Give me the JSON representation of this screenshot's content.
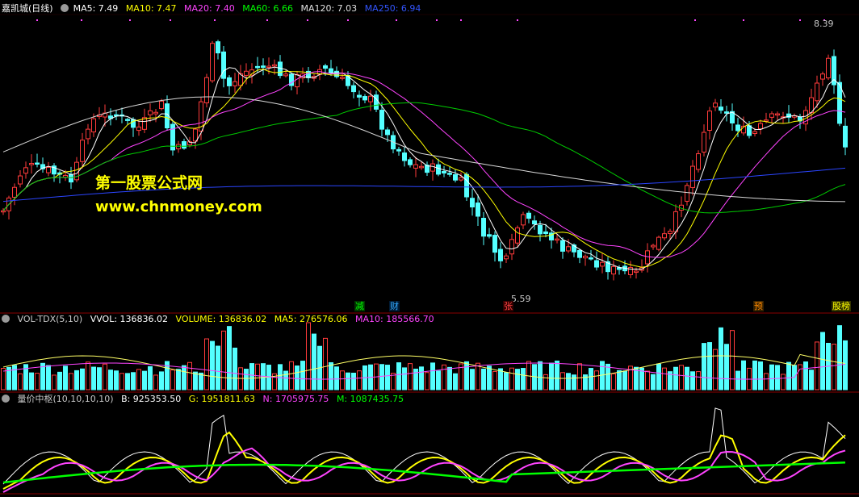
{
  "header_main": {
    "title": "嘉凯城(日线)",
    "items": [
      {
        "label": "MA5: 7.49",
        "color": "#ffffff"
      },
      {
        "label": "MA10: 7.47",
        "color": "#ffff00"
      },
      {
        "label": "MA20: 7.40",
        "color": "#ff44ff"
      },
      {
        "label": "MA60: 6.66",
        "color": "#00ff00"
      },
      {
        "label": "MA120: 7.03",
        "color": "#e0e0e0"
      },
      {
        "label": "MA250: 6.94",
        "color": "#3355ff"
      }
    ]
  },
  "header_vol": {
    "title": "VOL-TDX(5,10)",
    "items": [
      {
        "label": "VVOL: 136836.02",
        "color": "#ffffff"
      },
      {
        "label": "VOLUME: 136836.02",
        "color": "#ffff00"
      },
      {
        "label": "MA5: 276576.06",
        "color": "#ffff00"
      },
      {
        "label": "MA10: 185566.70",
        "color": "#ff44ff"
      }
    ]
  },
  "header_ind": {
    "title": "量价中枢(10,10,10,10)",
    "items": [
      {
        "label": "B: 925353.50",
        "color": "#ffffff"
      },
      {
        "label": "G: 1951811.63",
        "color": "#ffff00"
      },
      {
        "label": "N: 1705975.75",
        "color": "#ff44ff"
      },
      {
        "label": "M: 1087435.75",
        "color": "#00ff00"
      }
    ]
  },
  "watermark": {
    "line1": "第一股票公式网",
    "line2": "www.chnmoney.com"
  },
  "price_labels": {
    "high": "8.39",
    "low": "5.59"
  },
  "event_tags": [
    {
      "text": "减",
      "color": "#00ff00",
      "bg": "#003300"
    },
    {
      "text": "财",
      "color": "#33aaff",
      "bg": "#001a33"
    },
    {
      "text": "张",
      "color": "#ff4444",
      "bg": "#330000"
    },
    {
      "text": "预",
      "color": "#ff8800",
      "bg": "#332000"
    },
    {
      "text": "股榜",
      "color": "#ffff00",
      "bg": "#333300"
    }
  ],
  "colors": {
    "up": "#ff3b3b",
    "down": "#54ffff",
    "axis": "#8a0000"
  }
}
